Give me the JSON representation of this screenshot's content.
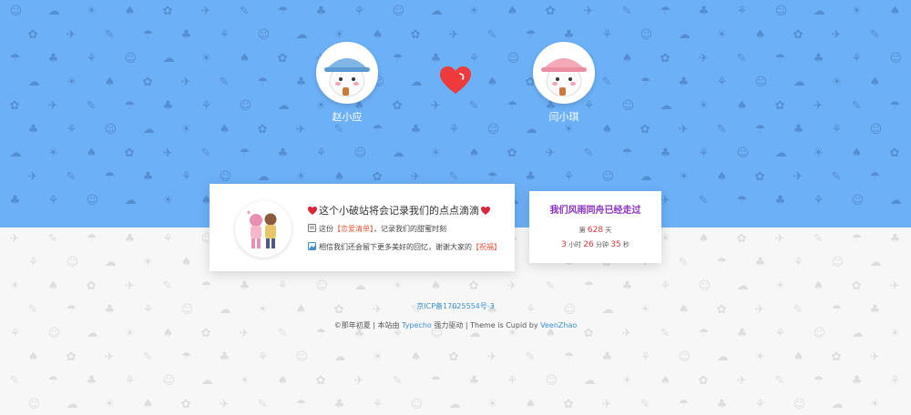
{
  "lovers": {
    "boy_name": "赵小应",
    "girl_name": "闫小琪"
  },
  "message": {
    "title": "这个小破站将会记录我们的点点滴滴",
    "line2_prefix": "这份",
    "line2_link": "【恋爱清单】",
    "line2_suffix": "，记录我们的甜蜜时刻",
    "line3_prefix": "相信我们还会留下更多美好的回忆，谢谢大家的",
    "line3_link": "【祝福】"
  },
  "counter": {
    "title": "我们风雨同舟已经走过",
    "days_prefix": "第",
    "days": "628",
    "days_unit": "天",
    "hours": "3",
    "hours_unit": "小时",
    "minutes": "26",
    "minutes_unit": "分钟",
    "seconds": "35",
    "seconds_unit": "秒"
  },
  "footer": {
    "icp": "京ICP备17025554号-3",
    "copyright": "©那年初夏",
    "sep1": " | 本站由 ",
    "typecho": "Typecho",
    "powered": " 强力驱动 | Theme is ",
    "cupid": "Cupid",
    "by": " by ",
    "author": "VeenZhao"
  },
  "colors": {
    "top_band": "#6cb0f7",
    "heart": "#ee3a3a",
    "counter_title": "#8a2fbf",
    "number": "#e0393e",
    "link": "#3a8fd1"
  },
  "icons": [
    "heart-icon",
    "notepad-icon",
    "photo-icon"
  ]
}
